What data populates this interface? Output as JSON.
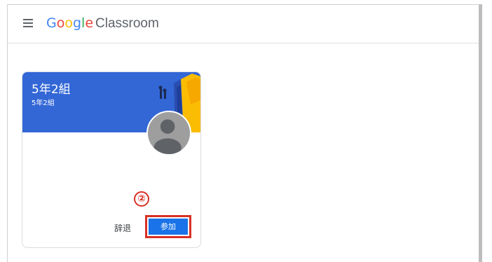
{
  "app": {
    "logo_word": "Google",
    "product_name": "Classroom"
  },
  "class_card": {
    "title": "5年2組",
    "subtitle": "5年2組",
    "decline_label": "辞退",
    "join_label": "参加",
    "step_marker": "②"
  },
  "colors": {
    "header_bg": "#3367d6",
    "join_button": "#1a73e8",
    "highlight": "#d93025"
  },
  "icons": {
    "menu": "hamburger-menu-icon",
    "avatar": "person-avatar-icon"
  }
}
